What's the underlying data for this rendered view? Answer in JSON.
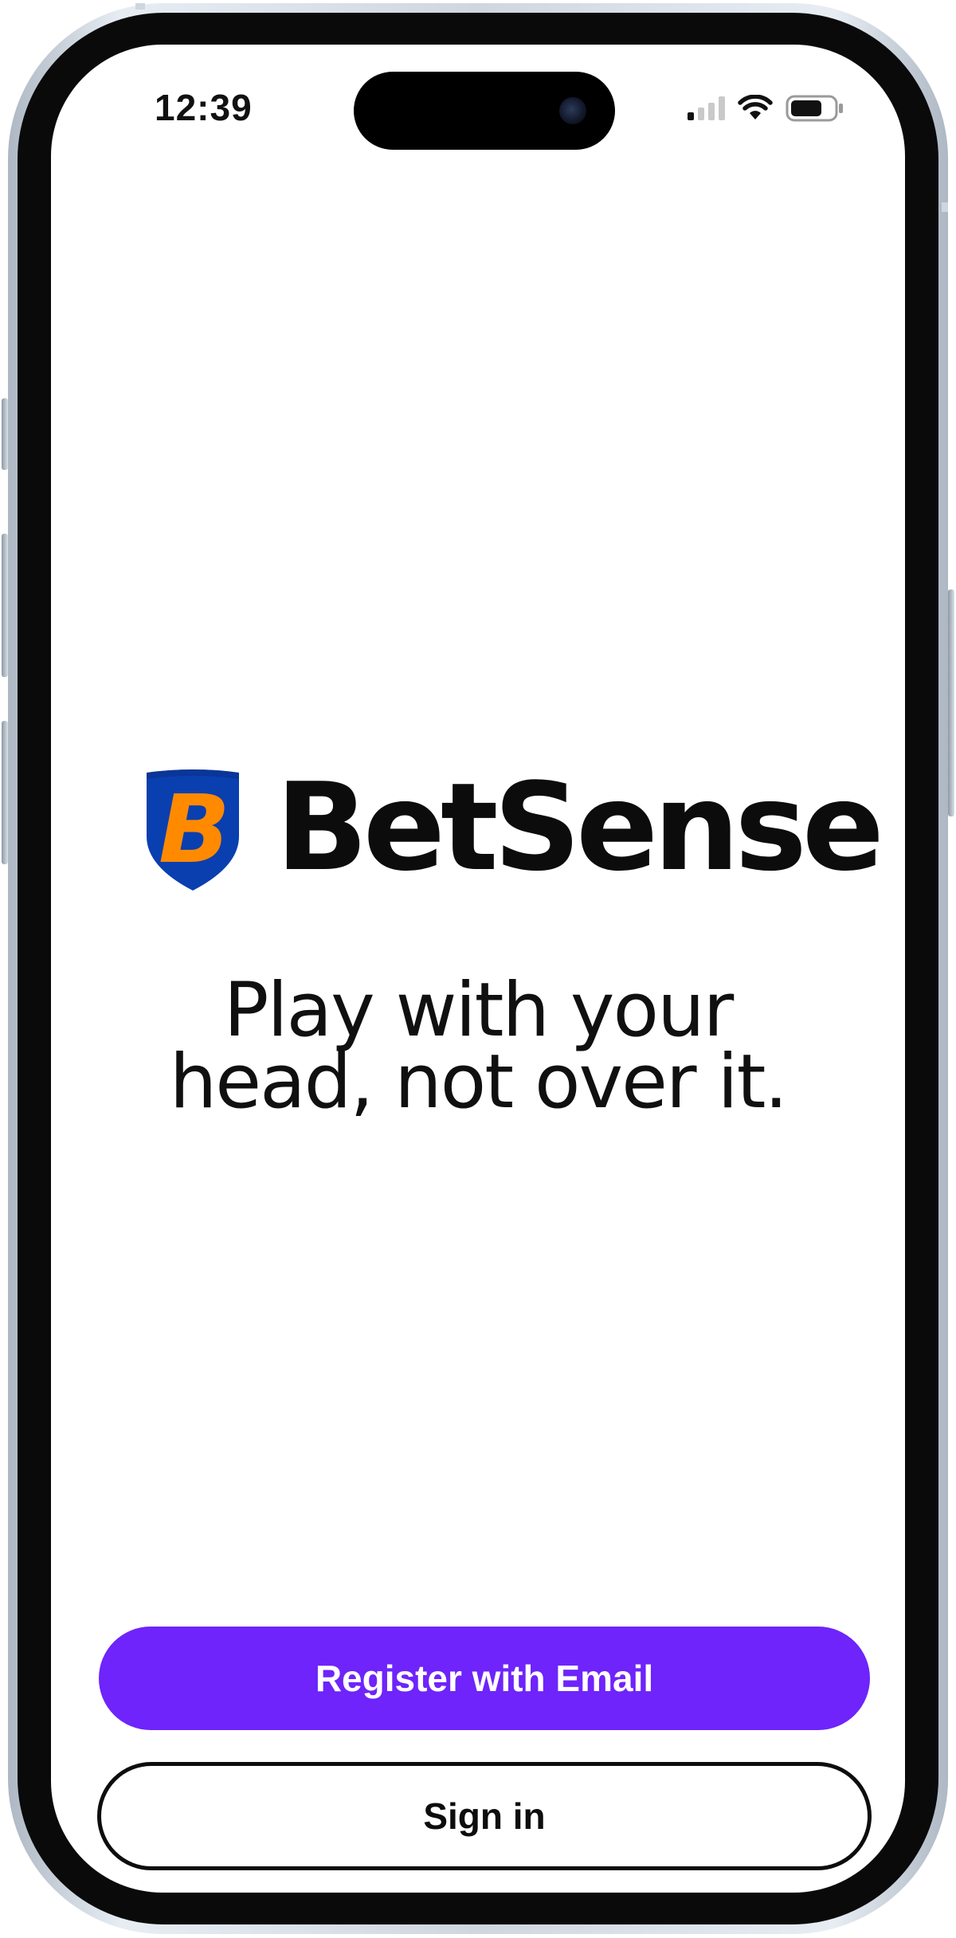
{
  "status_bar": {
    "time": "12:39",
    "icons": [
      "cellular-signal-icon",
      "wifi-icon",
      "battery-icon"
    ],
    "signal_bars_active": 1,
    "signal_bars_total": 4,
    "battery_level": 0.7
  },
  "brand": {
    "logo_letter": "B",
    "name": "BetSense",
    "logo_colors": {
      "shield": "#0a3fb0",
      "shield_edge": "#0a2f8a",
      "letter": "#ff8a00"
    }
  },
  "tagline": {
    "line1": "Play with your",
    "line2": "head, not over it."
  },
  "actions": {
    "register_label": "Register with Email",
    "signin_label": "Sign in"
  },
  "colors": {
    "primary": "#6e24fa",
    "text": "#0c0c0c",
    "background": "#ffffff"
  }
}
